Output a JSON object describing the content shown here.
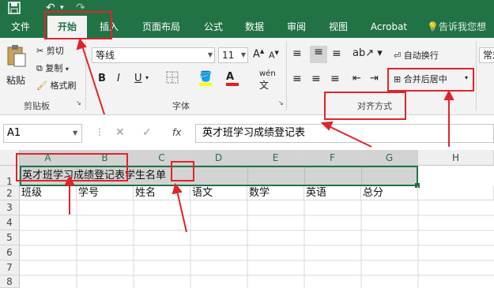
{
  "qat": {
    "save_icon": "save-icon",
    "undo_icon": "undo-icon",
    "redo_icon": "redo-icon"
  },
  "tabs": [
    "文件",
    "开始",
    "插入",
    "页面布局",
    "公式",
    "数据",
    "审阅",
    "视图",
    "Acrobat"
  ],
  "tell_me": "告诉我您想",
  "ribbon": {
    "paste": "粘贴",
    "cut": "剪切",
    "copy": "复制",
    "format_painter": "格式刷",
    "clipboard_group": "剪贴板",
    "font_name": "等线",
    "font_size": "11",
    "bold": "B",
    "italic": "I",
    "underline": "U",
    "wen": "wén",
    "font_group": "字体",
    "wrap_text": "自动换行",
    "merge_center": "合并后居中",
    "align_group": "对齐方式",
    "number_format": "常规"
  },
  "formula_bar": {
    "name_box": "A1",
    "fx": "fx",
    "content": "英才班学习成绩登记表"
  },
  "columns": [
    "A",
    "B",
    "C",
    "D",
    "E",
    "F",
    "G",
    "H"
  ],
  "rows": [
    "1",
    "2",
    "3",
    "4",
    "5",
    "6",
    "7",
    "8"
  ],
  "cells": {
    "a1": "英才班学习成绩登记表学生名单",
    "row2": [
      "班级",
      "学号",
      "姓名",
      "语文",
      "数学",
      "英语",
      "总分"
    ]
  }
}
